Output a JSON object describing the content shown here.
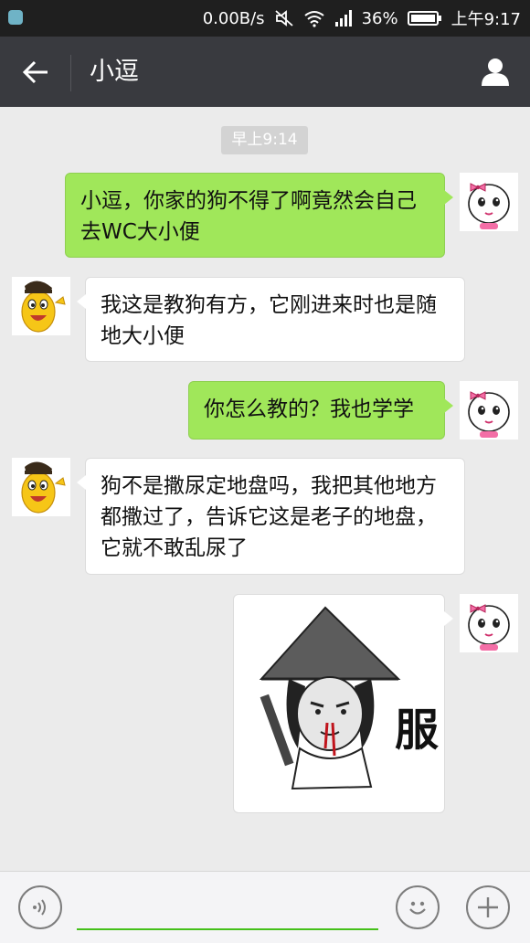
{
  "status_bar": {
    "speed": "0.00B/s",
    "battery": "36%",
    "time": "上午9:17"
  },
  "header": {
    "title": "小逗"
  },
  "chat": {
    "timestamp": "早上9:14",
    "messages": [
      {
        "side": "right",
        "text": "小逗，你家的狗不得了啊竟然会自己去WC大小便"
      },
      {
        "side": "left",
        "text": "我这是教狗有方，它刚进来时也是随地大小便"
      },
      {
        "side": "right",
        "text": "你怎么教的？我也学学"
      },
      {
        "side": "left",
        "text": "狗不是撒尿定地盘吗，我把其他地方都撒过了，告诉它这是老子的地盘，它就不敢乱尿了"
      }
    ],
    "sticker": {
      "caption": "服"
    }
  },
  "input_bar": {
    "value": ""
  },
  "colors": {
    "outgoing_bubble": "#a0e75a",
    "incoming_bubble": "#ffffff",
    "header_bg": "#393a3f",
    "accent_green": "#45c01a"
  }
}
